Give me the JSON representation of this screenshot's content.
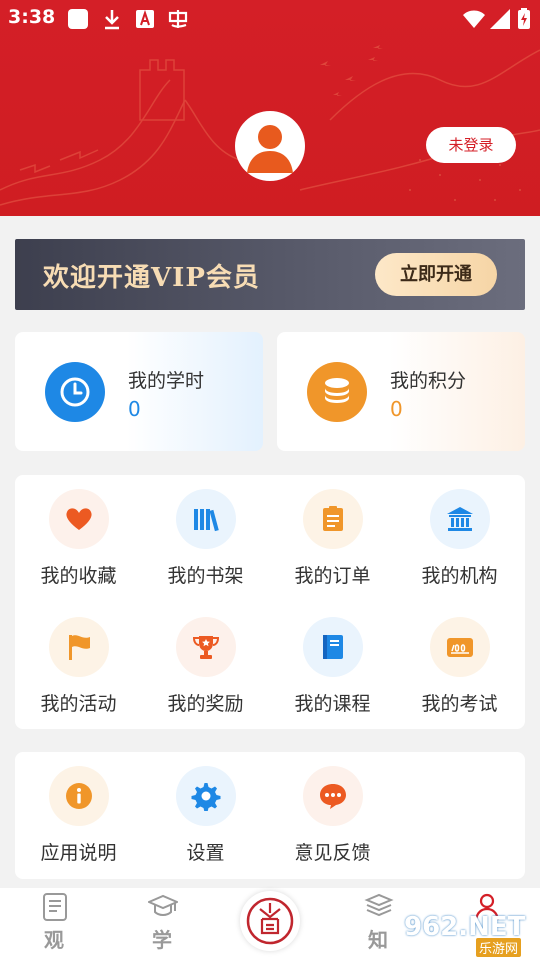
{
  "status_bar": {
    "time": "3:38",
    "icons": [
      "app-square-icon",
      "download-icon",
      "a-badge-icon",
      "chinese-app-icon",
      "wifi-icon",
      "signal-icon",
      "battery-charging-icon"
    ]
  },
  "header": {
    "login_label": "未登录",
    "avatar_icon": "user-avatar-icon",
    "background_color": "#d41f27"
  },
  "vip": {
    "title": "欢迎开通VIP会员",
    "button_label": "立即开通"
  },
  "stats": [
    {
      "label": "我的学时",
      "value": "0",
      "icon": "clock-icon",
      "color": "#1e88e5"
    },
    {
      "label": "我的积分",
      "value": "0",
      "icon": "coins-icon",
      "color": "#f0962a"
    }
  ],
  "features": {
    "items": [
      {
        "label": "我的收藏",
        "icon": "heart-icon"
      },
      {
        "label": "我的书架",
        "icon": "bookshelf-icon"
      },
      {
        "label": "我的订单",
        "icon": "clipboard-icon"
      },
      {
        "label": "我的机构",
        "icon": "institution-icon"
      },
      {
        "label": "我的活动",
        "icon": "flag-icon"
      },
      {
        "label": "我的奖励",
        "icon": "trophy-icon"
      },
      {
        "label": "我的课程",
        "icon": "book-icon"
      },
      {
        "label": "我的考试",
        "icon": "exam-score-icon"
      }
    ]
  },
  "tools": {
    "items": [
      {
        "label": "应用说明",
        "icon": "info-icon"
      },
      {
        "label": "设置",
        "icon": "settings-gear-icon"
      },
      {
        "label": "意见反馈",
        "icon": "feedback-chat-icon"
      }
    ]
  },
  "bottom_nav": {
    "items": [
      {
        "label": "观",
        "icon": "document-icon"
      },
      {
        "label": "学",
        "icon": "graduation-cap-icon"
      },
      {
        "label": "",
        "icon": "center-logo-icon"
      },
      {
        "label": "知",
        "icon": "books-stack-icon"
      },
      {
        "label": "",
        "icon": "profile-person-icon"
      }
    ]
  },
  "watermark": {
    "main": "962.NET",
    "sub": "乐游网"
  }
}
